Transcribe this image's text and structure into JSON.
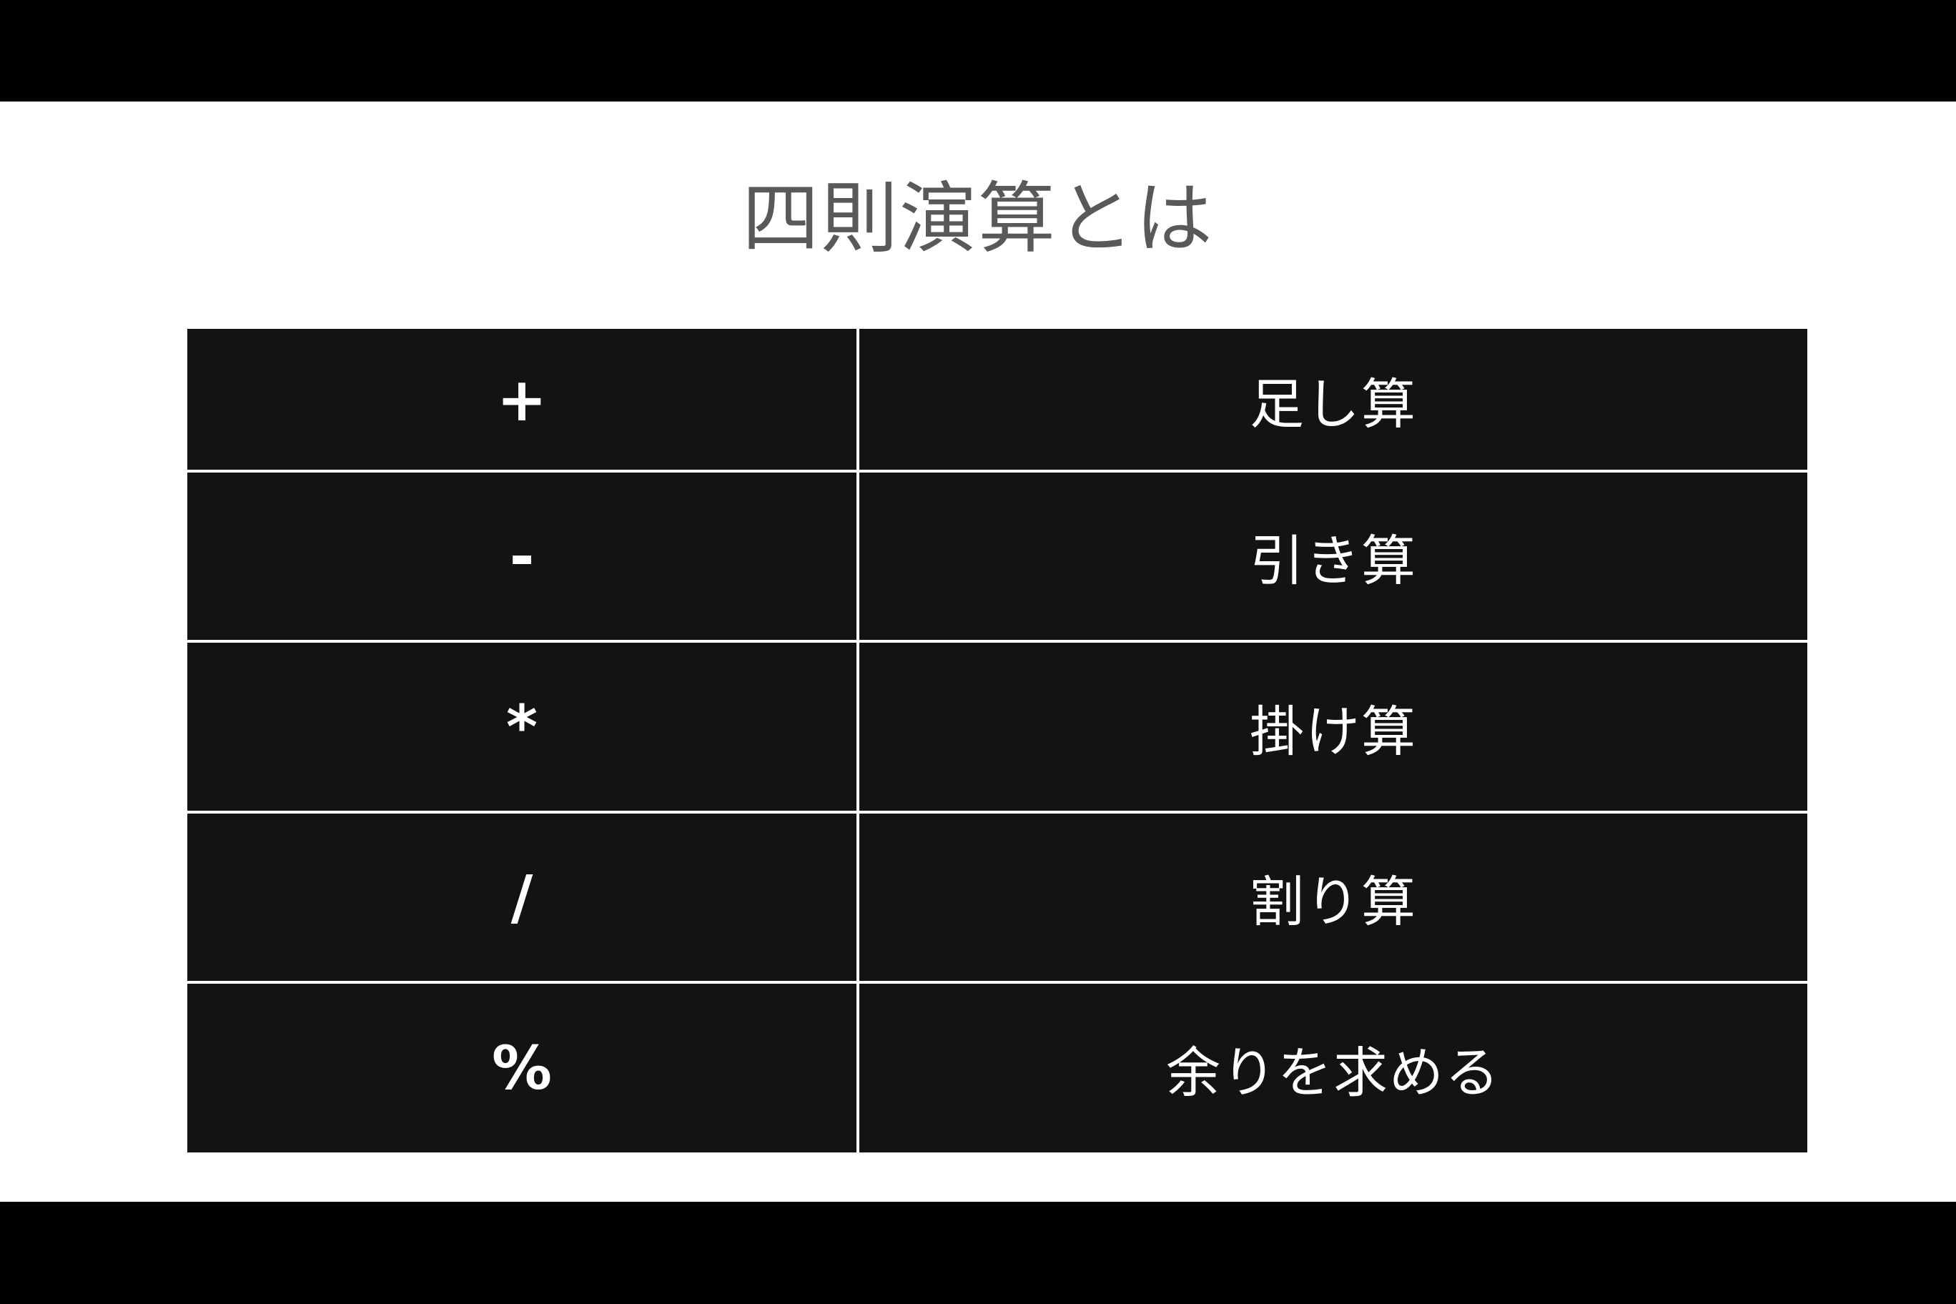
{
  "slide": {
    "title": "四則演算とは"
  },
  "table": {
    "rows": [
      {
        "operator": "+",
        "name": "足し算"
      },
      {
        "operator": "-",
        "name": "引き算"
      },
      {
        "operator": "*",
        "name": "掛け算"
      },
      {
        "operator": "/",
        "name": "割り算"
      },
      {
        "operator": "%",
        "name": "余りを求める"
      }
    ]
  },
  "colors": {
    "background": "#000000",
    "slide": "#ffffff",
    "title": "#595959",
    "cell": "#131313",
    "cell_text": "#ffffff"
  }
}
